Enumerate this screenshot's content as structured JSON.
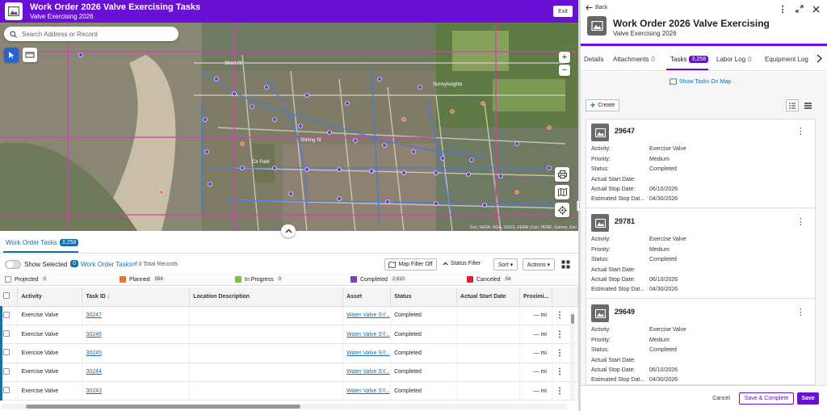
{
  "header": {
    "title": "Work Order 2026 Valve Exercising Tasks",
    "subtitle": "Valve Exercising 2026",
    "exit_label": "Exit"
  },
  "map": {
    "search_placeholder": "Search Address or Record",
    "attribution": "Esri, NASA, NGA, USGS, FEMA | Esri, HERE, Garmin, Esri",
    "labels": [
      {
        "text": "Short St",
        "name": "map-label-short-st"
      },
      {
        "text": "Sunnyheights",
        "name": "map-label-sunnyheights"
      },
      {
        "text": "Stirling St",
        "name": "map-label-stirling"
      },
      {
        "text": "Cir Park",
        "name": "map-label-cir-park"
      }
    ]
  },
  "tasks_tab": {
    "label": "Work Order Tasks",
    "count": "3,258"
  },
  "toolbar": {
    "show_selected": "Show Selected",
    "selected_count": "0",
    "wot_label": "Work Order Tasks",
    "of_total": "of 0 Total Records",
    "map_filter": "Map Filter Off",
    "status_filter": "Status Filter",
    "sort": "Sort ▾",
    "actions": "Actions ▾"
  },
  "statuses": [
    {
      "label": "Projected",
      "count": "0",
      "color": "#ffffff"
    },
    {
      "label": "Planned",
      "count": "594",
      "color": "#e8762c"
    },
    {
      "label": "In Progress",
      "count": "0",
      "color": "#7cc242"
    },
    {
      "label": "Completed",
      "count": "2,610",
      "color": "#7b3fb8"
    },
    {
      "label": "Canceled",
      "count": "54",
      "color": "#d9232d"
    }
  ],
  "table": {
    "columns": [
      "Activity",
      "Task ID ↓",
      "Location Description",
      "Asset",
      "Status",
      "Actual Start Date",
      "Proximi..."
    ],
    "rows": [
      {
        "activity": "Exercise Valve",
        "task_id": "30247",
        "location": "",
        "asset": "Water Valve SY...",
        "status": "Completed",
        "start": "",
        "prox": "— mi"
      },
      {
        "activity": "Exercise Valve",
        "task_id": "30246",
        "location": "",
        "asset": "Water Valve SY...",
        "status": "Completed",
        "start": "",
        "prox": "— mi"
      },
      {
        "activity": "Exercise Valve",
        "task_id": "30245",
        "location": "",
        "asset": "Water Valve SY...",
        "status": "Completed",
        "start": "",
        "prox": "— mi"
      },
      {
        "activity": "Exercise Valve",
        "task_id": "30244",
        "location": "",
        "asset": "Water Valve SY...",
        "status": "Completed",
        "start": "",
        "prox": "— mi"
      },
      {
        "activity": "Exercise Valve",
        "task_id": "30243",
        "location": "",
        "asset": "Water Valve SY...",
        "status": "Completed",
        "start": "",
        "prox": "— mi"
      }
    ]
  },
  "panel": {
    "back": "Back",
    "title": "Work Order 2026 Valve Exercising",
    "subtitle": "Valve Exercising 2026",
    "tabs": [
      {
        "label": "Details",
        "count": ""
      },
      {
        "label": "Attachments",
        "count": "0"
      },
      {
        "label": "Tasks",
        "count": "3,258"
      },
      {
        "label": "Labor Log",
        "count": "0"
      },
      {
        "label": "Equipment Log",
        "count": ""
      }
    ],
    "show_tasks_on_map": "Show Tasks On Map",
    "create": "Create",
    "field_labels": [
      "Activity:",
      "Priority:",
      "Status:",
      "Actual Start Date:",
      "Actual Stop Date:",
      "Estimated Stop Dat..."
    ],
    "cards": [
      {
        "id": "29647",
        "activity": "Exercise Valve",
        "priority": "Medium",
        "status": "Completed",
        "start": "",
        "stop": "06/10/2026",
        "est_stop": "04/30/2026"
      },
      {
        "id": "29781",
        "activity": "Exercise Valve",
        "priority": "Medium",
        "status": "Completed",
        "start": "",
        "stop": "06/10/2026",
        "est_stop": "04/30/2026"
      },
      {
        "id": "29649",
        "activity": "Exercise Valve",
        "priority": "Medium",
        "status": "Completed",
        "start": "",
        "stop": "06/10/2026",
        "est_stop": "04/30/2026"
      }
    ],
    "footer": {
      "cancel": "Cancel",
      "save_complete": "Save & Complete",
      "save": "Save"
    }
  },
  "colors": {
    "brand": "#6a0fd6",
    "link": "#1a6ea8"
  }
}
